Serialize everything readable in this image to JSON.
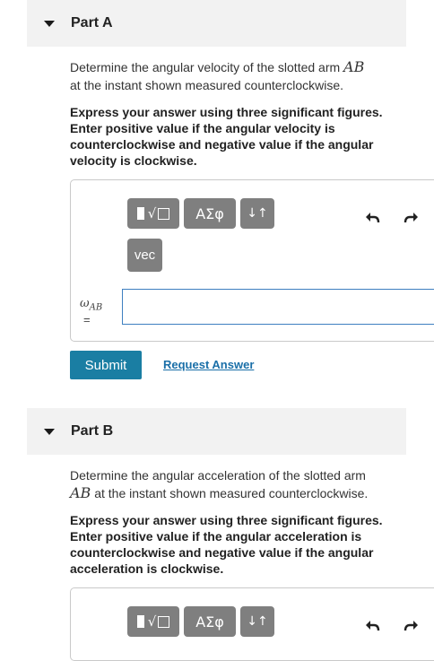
{
  "partA": {
    "title": "Part A",
    "question_pre": "Determine the angular velocity of the slotted arm ",
    "question_var": "AB",
    "question_post": "at the instant shown measured counterclockwise.",
    "instruction": "Express your answer using three significant figures. Enter positive value if the angular velocity is counterclockwise and negative value if the angular velocity is clockwise.",
    "toolbar": {
      "greek_label": "ΑΣφ",
      "arrows_label": "↓↑",
      "vec_label": "vec"
    },
    "answer_label_symbol": "ω",
    "answer_label_sub": "AB",
    "answer_label_eq": "=",
    "input_value": "",
    "submit_label": "Submit",
    "request_label": "Request Answer"
  },
  "partB": {
    "title": "Part B",
    "question_pre": "Determine the angular acceleration of the slotted arm",
    "question_var": "AB",
    "question_post": " at the instant shown measured counterclockwise.",
    "instruction": "Express your answer using three significant figures. Enter positive value if the angular acceleration is counterclockwise and negative value if the angular acceleration is clockwise.",
    "toolbar": {
      "greek_label": "ΑΣφ",
      "arrows_label": "↓↑"
    }
  },
  "colors": {
    "submit_bg": "#1a7ea3",
    "toolbar_btn": "#7f7f7f",
    "input_border": "#3e7fc0",
    "link": "#1a6fa8"
  }
}
